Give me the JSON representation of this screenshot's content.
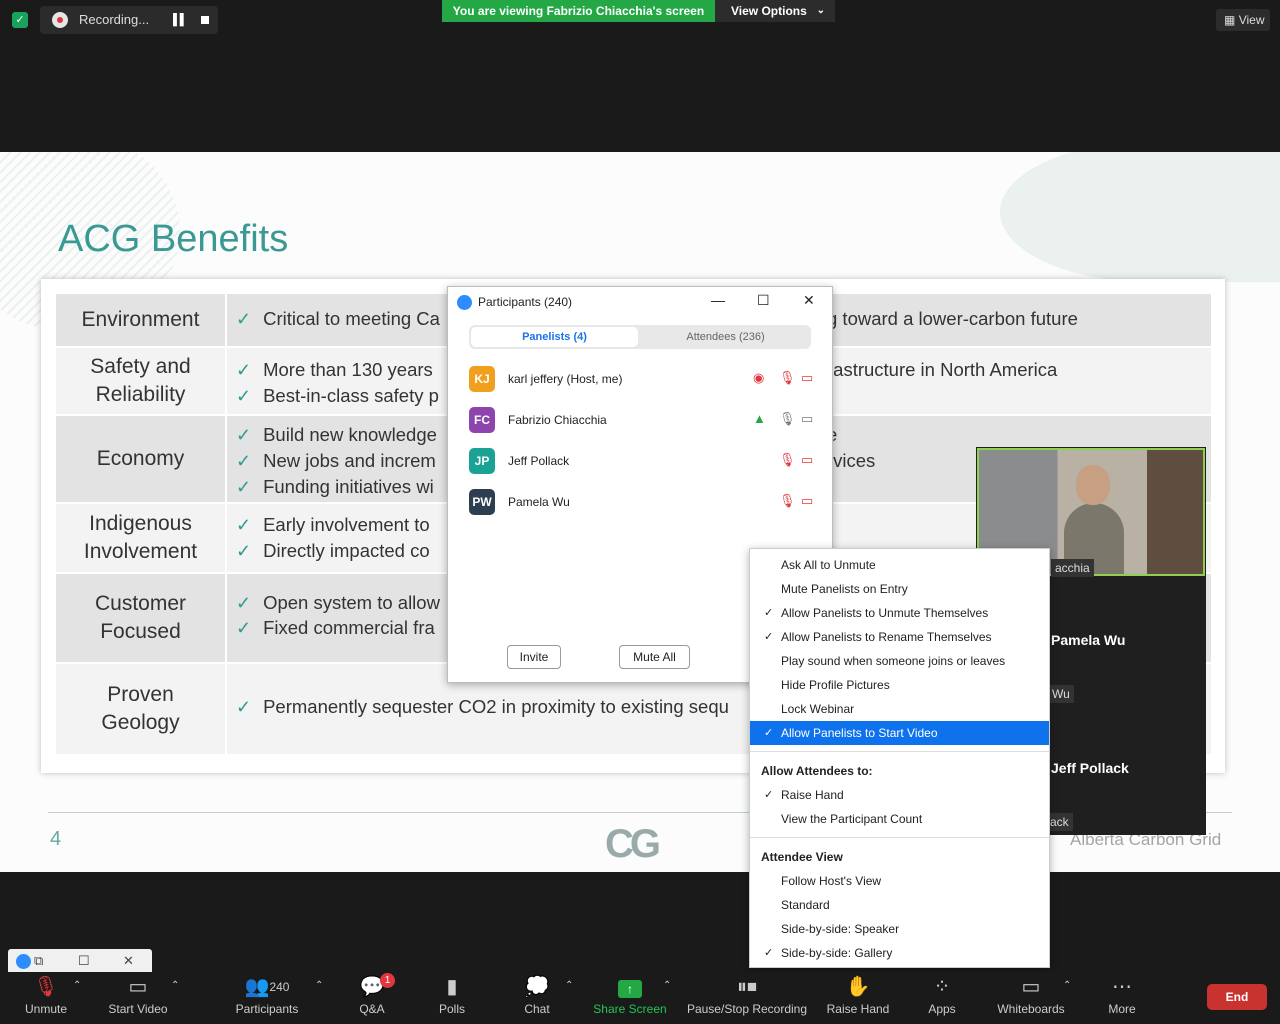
{
  "topbar": {
    "recording_label": "Recording...",
    "viewing_banner": "You are viewing Fabrizio Chiacchia's screen",
    "view_options_label": "View Options",
    "view_label": "View"
  },
  "slide": {
    "title": "ACG Benefits",
    "rows": [
      {
        "category": "Environment",
        "lines": [
          "Critical to meeting Ca",
          "g toward a lower-carbon future"
        ]
      },
      {
        "category": "Safety and Reliability",
        "lines": [
          "More than 130 years",
          "Best-in-class safety p",
          "rastructure in North America"
        ]
      },
      {
        "category": "Economy",
        "lines": [
          "Build new knowledge",
          "New jobs and increm",
          "Funding initiatives wi",
          "e",
          "rvices"
        ]
      },
      {
        "category": "Indigenous Involvement",
        "lines": [
          "Early involvement to",
          "Directly impacted co"
        ]
      },
      {
        "category": "Customer Focused",
        "lines": [
          "Open system to allow",
          "Fixed commercial fra"
        ]
      },
      {
        "category": "Proven Geology",
        "lines": [
          "Permanently sequester CO2 in proximity to existing sequ"
        ]
      }
    ],
    "page_number": "4",
    "brand": "Alberta Carbon Grid",
    "logo_text": "CG"
  },
  "participants_window": {
    "title": "Participants (240)",
    "tab_panelists": "Panelists (4)",
    "tab_attendees": "Attendees (236)",
    "panelists": [
      {
        "initials": "KJ",
        "name": "karl jeffery (Host, me)",
        "color": "#f0a01e"
      },
      {
        "initials": "FC",
        "name": "Fabrizio Chiacchia",
        "color": "#8e44ad"
      },
      {
        "initials": "JP",
        "name": "Jeff Pollack",
        "color": "#1aa394"
      },
      {
        "initials": "PW",
        "name": "Pamela Wu",
        "color": "#2c3e50"
      }
    ],
    "invite_label": "Invite",
    "mute_all_label": "Mute All"
  },
  "video_panel": {
    "speaker_name_fragment": "acchia",
    "tile2_name": "Pamela Wu",
    "tile2_small": "Wu",
    "tile3_name": "Jeff Pollack",
    "tile3_small": "ack"
  },
  "menu": {
    "items1": [
      {
        "label": "Ask All to Unmute",
        "checked": false
      },
      {
        "label": "Mute Panelists on Entry",
        "checked": false
      },
      {
        "label": "Allow Panelists to Unmute Themselves",
        "checked": true
      },
      {
        "label": "Allow Panelists to Rename Themselves",
        "checked": true
      },
      {
        "label": "Play sound when someone joins or leaves",
        "checked": false
      },
      {
        "label": "Hide Profile Pictures",
        "checked": false
      },
      {
        "label": "Lock Webinar",
        "checked": false
      },
      {
        "label": "Allow Panelists to Start Video",
        "checked": true
      }
    ],
    "attendees_header": "Allow Attendees to:",
    "items2": [
      {
        "label": "Raise Hand",
        "checked": true
      },
      {
        "label": "View the Participant Count",
        "checked": false
      }
    ],
    "attendee_view_header": "Attendee View",
    "items3": [
      {
        "label": "Follow Host's View",
        "checked": false
      },
      {
        "label": "Standard",
        "checked": false
      },
      {
        "label": "Side-by-side: Speaker",
        "checked": false
      },
      {
        "label": "Side-by-side: Gallery",
        "checked": true
      }
    ]
  },
  "toolbar": {
    "unmute": "Unmute",
    "start_video": "Start Video",
    "participants": "Participants",
    "participant_count": "240",
    "qa": "Q&A",
    "qa_badge": "1",
    "polls": "Polls",
    "chat": "Chat",
    "share_screen": "Share Screen",
    "recording": "Pause/Stop Recording",
    "raise_hand": "Raise Hand",
    "apps": "Apps",
    "whiteboards": "Whiteboards",
    "more": "More",
    "end": "End"
  }
}
